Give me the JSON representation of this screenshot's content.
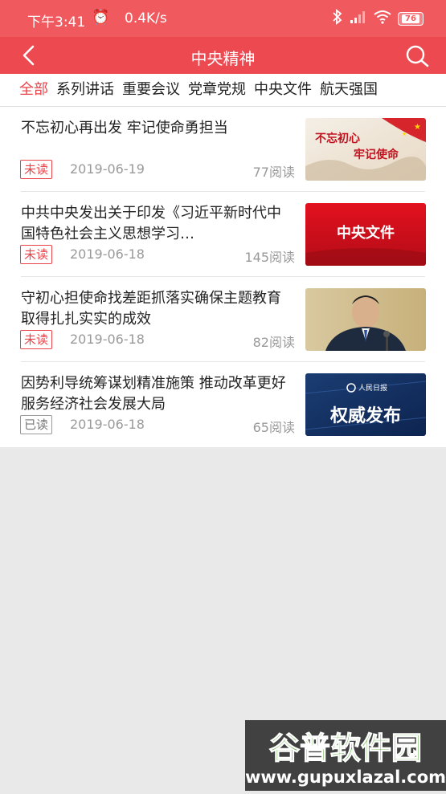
{
  "status_bar": {
    "time": "下午3:41",
    "speed": "0.4K/s",
    "battery": "76"
  },
  "header": {
    "title": "中央精神"
  },
  "tabs": [
    "全部",
    "系列讲话",
    "重要会议",
    "党章党规",
    "中央文件",
    "航天强国"
  ],
  "articles": [
    {
      "title": "不忘初心再出发 牢记使命勇担当",
      "badge": "未读",
      "date": "2019-06-19",
      "views": "77阅读",
      "thumb_text": "不忘初心 牢记使命"
    },
    {
      "title": "中共中央发出关于印发《习近平新时代中国特色社会主义思想学习…",
      "badge": "未读",
      "date": "2019-06-18",
      "views": "145阅读",
      "thumb_text": "中央文件"
    },
    {
      "title": "守初心担使命找差距抓落实确保主题教育取得扎扎实实的成效",
      "badge": "未读",
      "date": "2019-06-18",
      "views": "82阅读",
      "thumb_text": ""
    },
    {
      "title": "因势利导统筹谋划精准施策 推动改革更好服务经济社会发展大局",
      "badge": "已读",
      "date": "2019-06-18",
      "views": "65阅读",
      "thumb_text": "权威发布",
      "thumb_sub": "人民日报"
    }
  ],
  "watermark": {
    "brand": "谷普软件园",
    "url": "www.gupuxlazal.com"
  }
}
